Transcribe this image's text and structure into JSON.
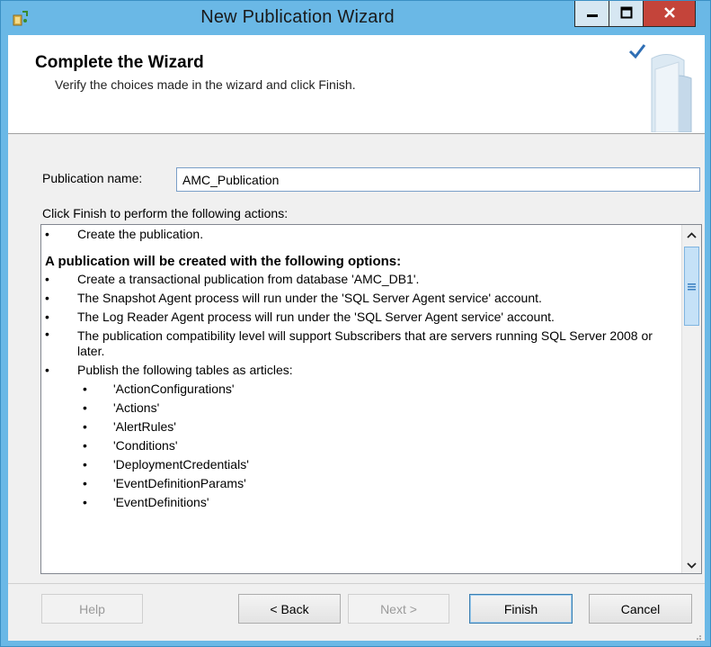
{
  "window": {
    "title": "New Publication Wizard",
    "icon": "publication-wizard-icon",
    "controls": [
      "minimize-icon",
      "maximize-icon",
      "close-icon"
    ]
  },
  "header": {
    "title": "Complete the Wizard",
    "subtitle": "Verify the choices made in the wizard and click Finish.",
    "art_icon": "book-checkmark-icon"
  },
  "publication": {
    "label": "Publication name:",
    "value": "AMC_Publication"
  },
  "actions_label": "Click Finish to perform the following actions:",
  "summary": {
    "first_item": "Create the publication.",
    "section_heading": "A publication will be created with the following options:",
    "items": [
      "Create a transactional publication from database 'AMC_DB1'.",
      "The Snapshot Agent process will run under the 'SQL Server Agent service' account.",
      "The Log Reader Agent process will run under the 'SQL Server Agent service' account.",
      "The publication compatibility level will support Subscribers that are servers running SQL Server 2008 or later.",
      "Publish the following tables as articles:"
    ],
    "articles": [
      "'ActionConfigurations'",
      "'Actions'",
      "'AlertRules'",
      "'Conditions'",
      "'DeploymentCredentials'",
      "'EventDefinitionParams'",
      "'EventDefinitions'"
    ],
    "bullet": "•"
  },
  "buttons": {
    "help": "Help",
    "back": "< Back",
    "next": "Next >",
    "finish": "Finish",
    "cancel": "Cancel"
  },
  "colors": {
    "titlebar": "#6ab8e6",
    "close_button": "#c4443a",
    "scroll_thumb": "#c5e1f7"
  }
}
